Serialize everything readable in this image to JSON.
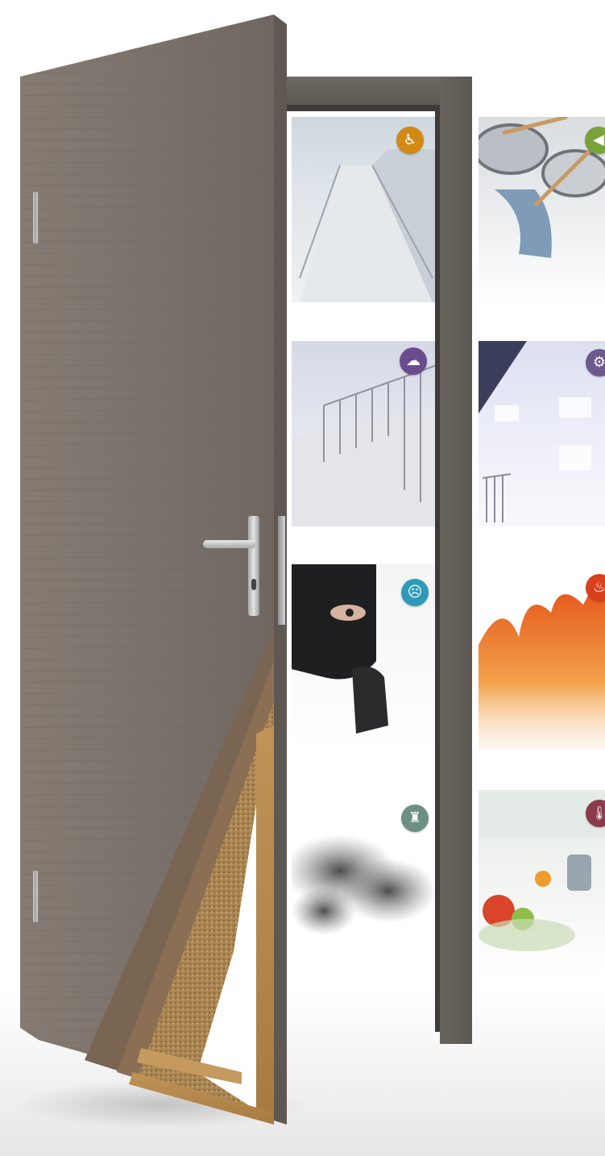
{
  "scene": {
    "subject": "door-cutaway",
    "door_color": "#7d746d",
    "frame_color": "#615b56",
    "core_color": "#b8894d"
  },
  "tiles": [
    {
      "name": "accessibility",
      "icon": "wheelchair-icon",
      "glyph": "♿",
      "color": "#d28a14"
    },
    {
      "name": "sound",
      "icon": "speaker-icon",
      "glyph": "◀",
      "color": "#7aa23c"
    },
    {
      "name": "climate",
      "icon": "cloud-icon",
      "glyph": "☁",
      "color": "#6a4c8c"
    },
    {
      "name": "mechanical",
      "icon": "gear-icon",
      "glyph": "⚙",
      "color": "#6b5a8e"
    },
    {
      "name": "security",
      "icon": "burglar-icon",
      "glyph": "☹",
      "color": "#2e9ab8"
    },
    {
      "name": "fire",
      "icon": "flame-icon",
      "glyph": "♨",
      "color": "#d9401c"
    },
    {
      "name": "smoke",
      "icon": "smoke-icon",
      "glyph": "♜",
      "color": "#6d8f86"
    },
    {
      "name": "thermal",
      "icon": "thermometer-icon",
      "glyph": "🌡",
      "color": "#8a3b4a"
    }
  ]
}
